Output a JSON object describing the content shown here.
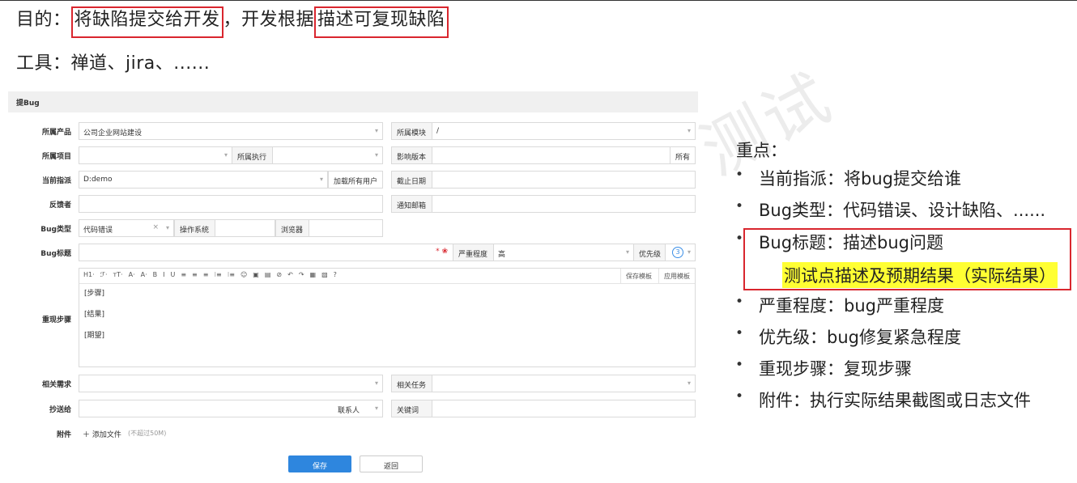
{
  "slide": {
    "line1": {
      "prefix": "目的：",
      "highlight1": "将缺陷提交给开发",
      "middle": "，开发根据",
      "highlight2": "描述可复现缺陷"
    },
    "line2": "工具：禅道、jira、......",
    "watermark": "测试"
  },
  "form": {
    "title": "提Bug",
    "product_label": "所属产品",
    "product_value": "公司企业网站建设",
    "module_label": "所属模块",
    "module_value": "/",
    "project_label": "所属项目",
    "execution_label": "所属执行",
    "version_label": "影响版本",
    "version_addon": "所有",
    "assign_label": "当前指派",
    "assign_value": "D:demo",
    "load_users": "加载所有用户",
    "deadline_label": "截止日期",
    "feedback_label": "反馈者",
    "notify_label": "通知邮箱",
    "type_label": "Bug类型",
    "type_value": "代码错误",
    "clear_icon": "×",
    "os_label": "操作系统",
    "browser_label": "浏览器",
    "bugtitle_label": "Bug标题",
    "severity_label": "严重程度",
    "severity_value": "高",
    "priority_label": "优先级",
    "priority_value": "3",
    "steps_label": "重现步骤",
    "toolbar": [
      "H1·",
      "ℱ·",
      "тT·",
      "A·",
      "A·",
      "B",
      "I",
      "U",
      "≡",
      "≡",
      "≡",
      "⁝≡",
      "⁝≡",
      "☺",
      "▣",
      "▤",
      "⊘",
      "↶",
      "↷",
      "▦",
      "▧",
      "?"
    ],
    "save_template": "保存模板",
    "apply_template": "应用模板",
    "steps_lines": [
      "[步骤]",
      "[结果]",
      "[期望]"
    ],
    "story_label": "相关需求",
    "task_label": "相关任务",
    "cc_label": "抄送给",
    "contacts": "联系人",
    "keywords_label": "关键词",
    "attach_label": "附件",
    "add_file": "＋ 添加文件",
    "size_limit": "(不超过50M)",
    "save_button": "保存",
    "back_button": "返回"
  },
  "notes": {
    "title": "重点：",
    "items": [
      "当前指派：将bug提交给谁",
      "Bug类型：代码错误、设计缺陷、......",
      "Bug标题：描述bug问题",
      "严重程度：bug严重程度",
      "优先级：bug修复紧急程度",
      "重现步骤：复现步骤",
      "附件：执行实际结果截图或日志文件"
    ],
    "highlight": "测试点描述及预期结果（实际结果）"
  },
  "colors": {
    "accent": "#2e86de",
    "highlight_border": "#d9262e",
    "highlight_fill": "#ffff33"
  }
}
